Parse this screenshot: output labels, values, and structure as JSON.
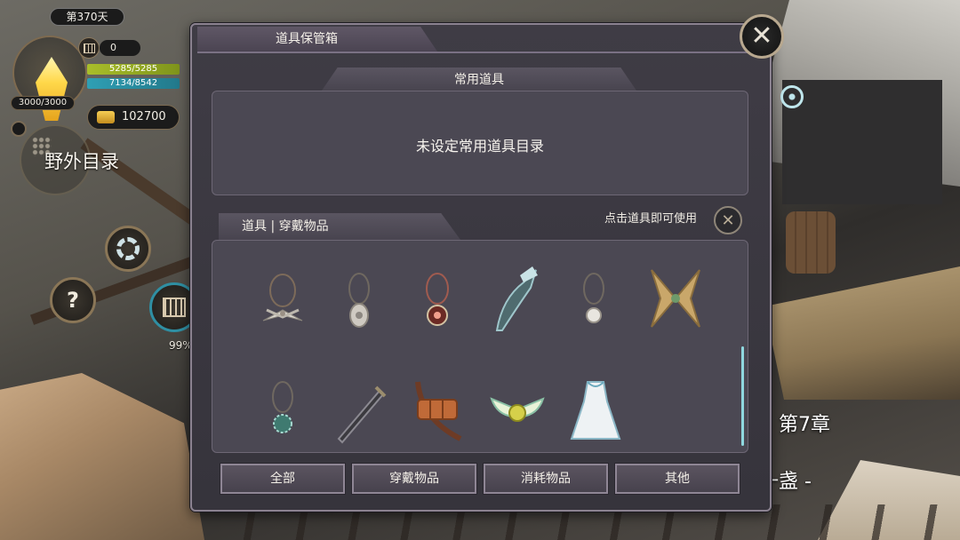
{
  "hud": {
    "day": "第370天",
    "crystal_value": "3000/3000",
    "calendar_count": "0",
    "hp": "5285/5285",
    "mp": "7134/8542",
    "gold": "102700",
    "field_directory": "野外目录",
    "percent": "99%",
    "chapter": "第7章",
    "chapter_subtitle": "后一盏 -"
  },
  "modal": {
    "title": "道具保管箱",
    "close_symbol": "✕",
    "common": {
      "header": "常用道具",
      "empty_message": "未设定常用道具目录"
    },
    "inventory": {
      "tab": "道具 | 穿戴物品",
      "hint": "点击道具即可使用",
      "hint_symbol": "✕",
      "items": [
        {
          "icon": "crossed-wings-necklace-icon"
        },
        {
          "icon": "silver-pendant-necklace-icon"
        },
        {
          "icon": "ruby-amulet-necklace-icon"
        },
        {
          "icon": "crystal-blade-weapon-icon"
        },
        {
          "icon": "pearl-pendant-necklace-icon"
        },
        {
          "icon": "golden-wings-accessory-icon"
        },
        {
          "icon": "spiked-orb-necklace-icon"
        },
        {
          "icon": "dark-sword-icon"
        },
        {
          "icon": "leather-pouch-belt-icon"
        },
        {
          "icon": "winged-charm-icon"
        },
        {
          "icon": "white-dress-armor-icon"
        }
      ]
    },
    "filters": [
      "全部",
      "穿戴物品",
      "消耗物品",
      "其他"
    ]
  },
  "colors": {
    "panel_bg": "#4b4853",
    "modal_bg": "#3f3c45",
    "accent_cyan": "#8fd8df",
    "hp_green": "#a9be2a",
    "mp_blue": "#2f9fb4"
  }
}
